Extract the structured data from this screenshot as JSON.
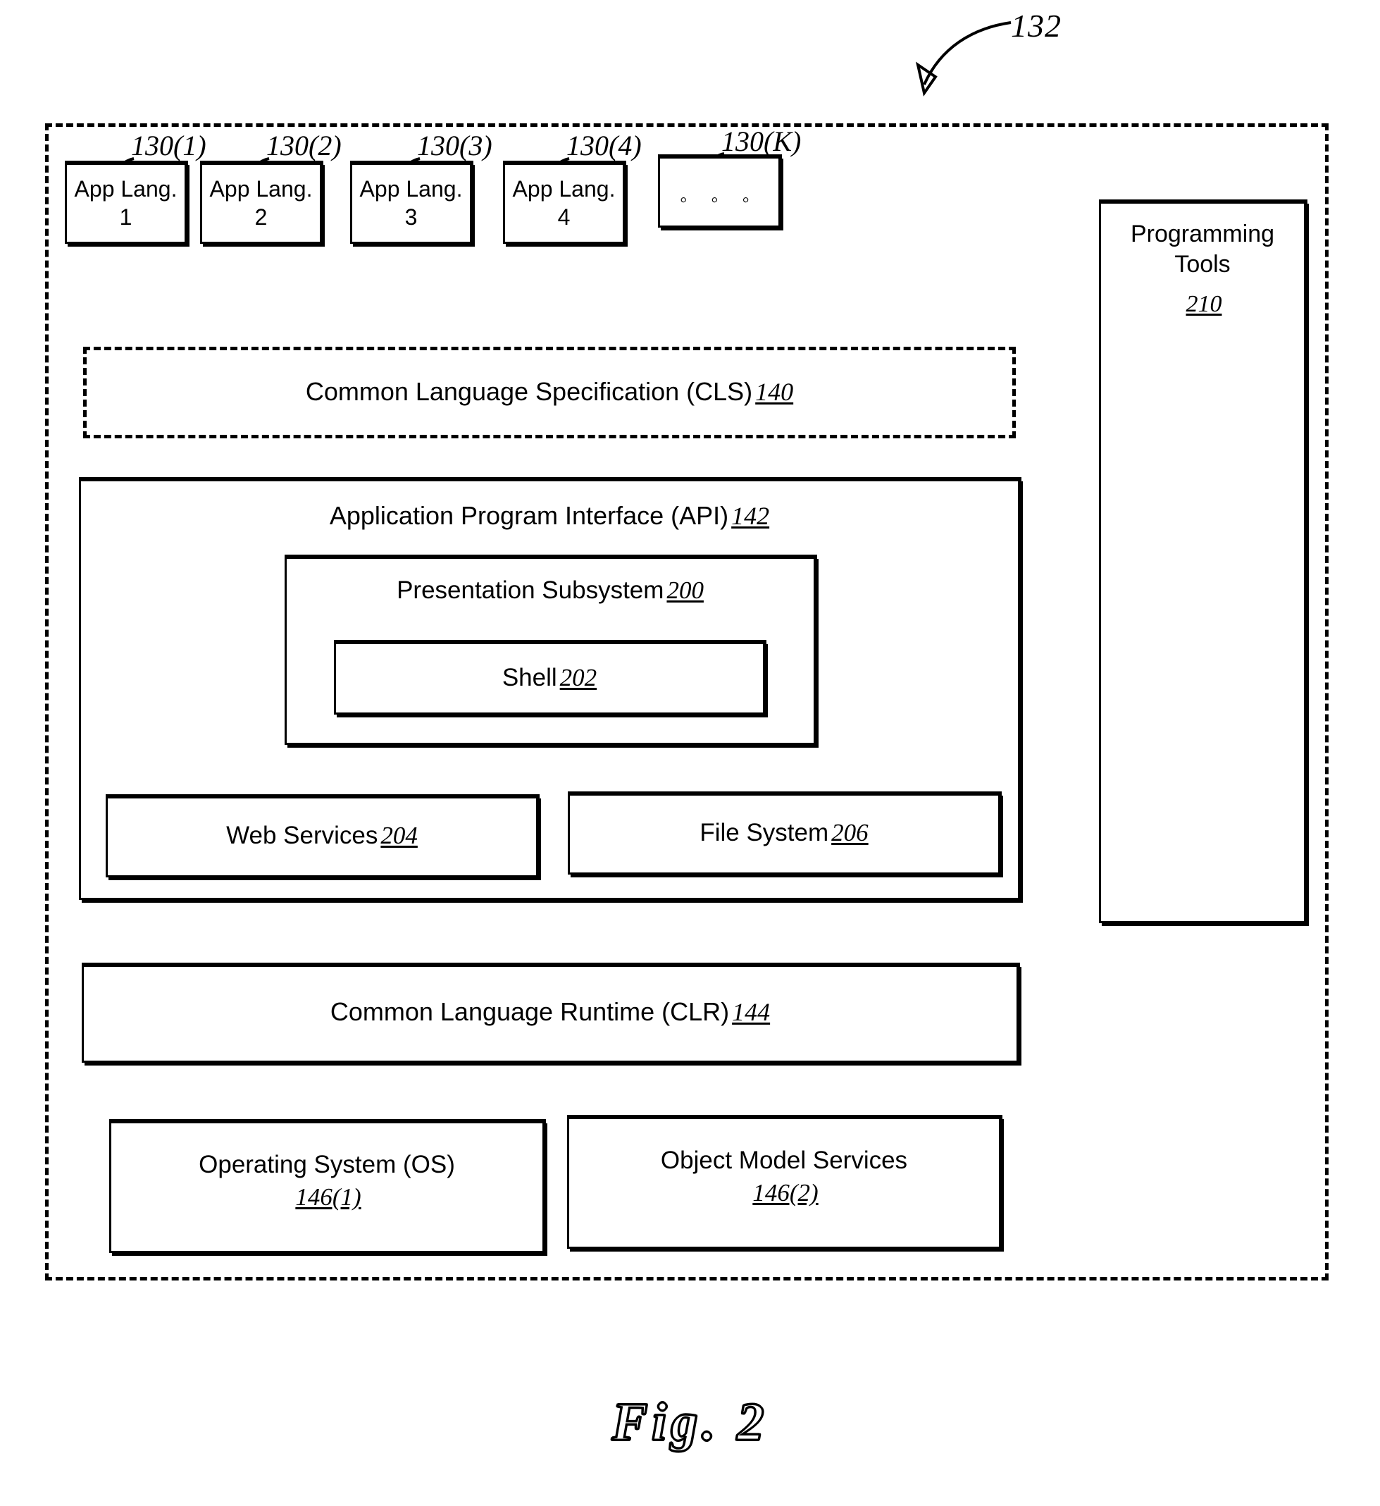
{
  "figure": {
    "caption": "Fig.  2",
    "overall_ref": "132"
  },
  "app_languages": {
    "items": [
      {
        "line1": "App Lang.",
        "line2": "1",
        "callout": "130(1)"
      },
      {
        "line1": "App Lang.",
        "line2": "2",
        "callout": "130(2)"
      },
      {
        "line1": "App Lang.",
        "line2": "3",
        "callout": "130(3)"
      },
      {
        "line1": "App Lang.",
        "line2": "4",
        "callout": "130(4)"
      }
    ],
    "more": {
      "dots": "◦ ◦ ◦",
      "callout": "130(K)"
    }
  },
  "programming_tools": {
    "title": "Programming Tools",
    "ref": "210"
  },
  "cls": {
    "label": "Common Language Specification (CLS)",
    "ref": "140"
  },
  "api": {
    "label": "Application Program Interface (API)",
    "ref": "142"
  },
  "presentation_subsystem": {
    "label": "Presentation Subsystem",
    "ref": "200"
  },
  "shell": {
    "label": "Shell",
    "ref": "202"
  },
  "web_services": {
    "label": "Web Services",
    "ref": "204"
  },
  "file_system": {
    "label": "File System",
    "ref": "206"
  },
  "clr": {
    "label": "Common Language Runtime (CLR)",
    "ref": "144"
  },
  "operating_system": {
    "label": "Operating System (OS)",
    "ref": "146(1)"
  },
  "object_model_services": {
    "label": "Object Model Services",
    "ref": "146(2)"
  },
  "colors": {
    "stroke": "#000000",
    "background": "#ffffff"
  }
}
